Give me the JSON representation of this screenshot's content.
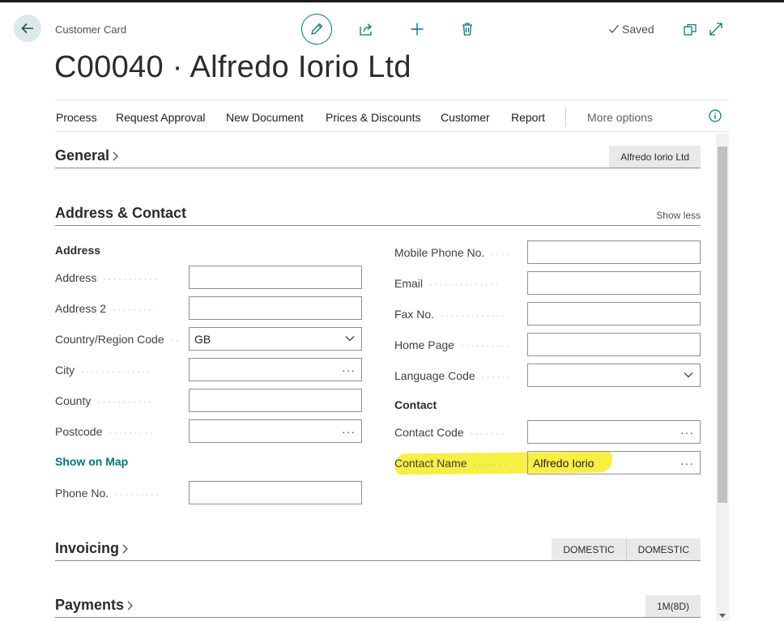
{
  "header": {
    "breadcrumb": "Customer Card",
    "title": "C00040 · Alfredo Iorio Ltd",
    "saved_label": "Saved"
  },
  "actions": [
    "Process",
    "Request Approval",
    "New Document",
    "Prices & Discounts",
    "Customer",
    "Report"
  ],
  "more_options": "More options",
  "sections": {
    "general": {
      "title": "General",
      "summary": [
        "Alfredo Iorio Ltd"
      ]
    },
    "address_contact": {
      "title": "Address & Contact",
      "show_less": "Show less"
    },
    "invoicing": {
      "title": "Invoicing",
      "summary": [
        "DOMESTIC",
        "DOMESTIC"
      ]
    },
    "payments": {
      "title": "Payments",
      "summary": [
        "1M(8D)"
      ]
    }
  },
  "address_group": {
    "label": "Address",
    "fields": [
      {
        "label": "Address",
        "value": ""
      },
      {
        "label": "Address 2",
        "value": ""
      },
      {
        "label": "Country/Region Code",
        "value": "GB"
      },
      {
        "label": "City",
        "value": ""
      },
      {
        "label": "County",
        "value": ""
      },
      {
        "label": "Postcode",
        "value": ""
      }
    ],
    "show_on_map": "Show on Map",
    "phone": {
      "label": "Phone No.",
      "value": ""
    }
  },
  "right_fields": [
    {
      "label": "Mobile Phone No.",
      "value": ""
    },
    {
      "label": "Email",
      "value": ""
    },
    {
      "label": "Fax No.",
      "value": ""
    },
    {
      "label": "Home Page",
      "value": ""
    },
    {
      "label": "Language Code",
      "value": ""
    }
  ],
  "contact_group": {
    "label": "Contact",
    "contact_code": {
      "label": "Contact Code",
      "value": ""
    },
    "contact_name": {
      "label": "Contact Name",
      "value": "Alfredo Iorio"
    }
  },
  "colors": {
    "accent": "#00777a",
    "highlight": "#f6ee34"
  },
  "icons": [
    "back-arrow-icon",
    "pencil-icon",
    "share-icon",
    "plus-icon",
    "trash-icon",
    "checkmark-icon",
    "open-new-window-icon",
    "expand-icon",
    "info-icon",
    "chevron-right-icon",
    "chevron-down-icon",
    "ellipsis-icon"
  ]
}
